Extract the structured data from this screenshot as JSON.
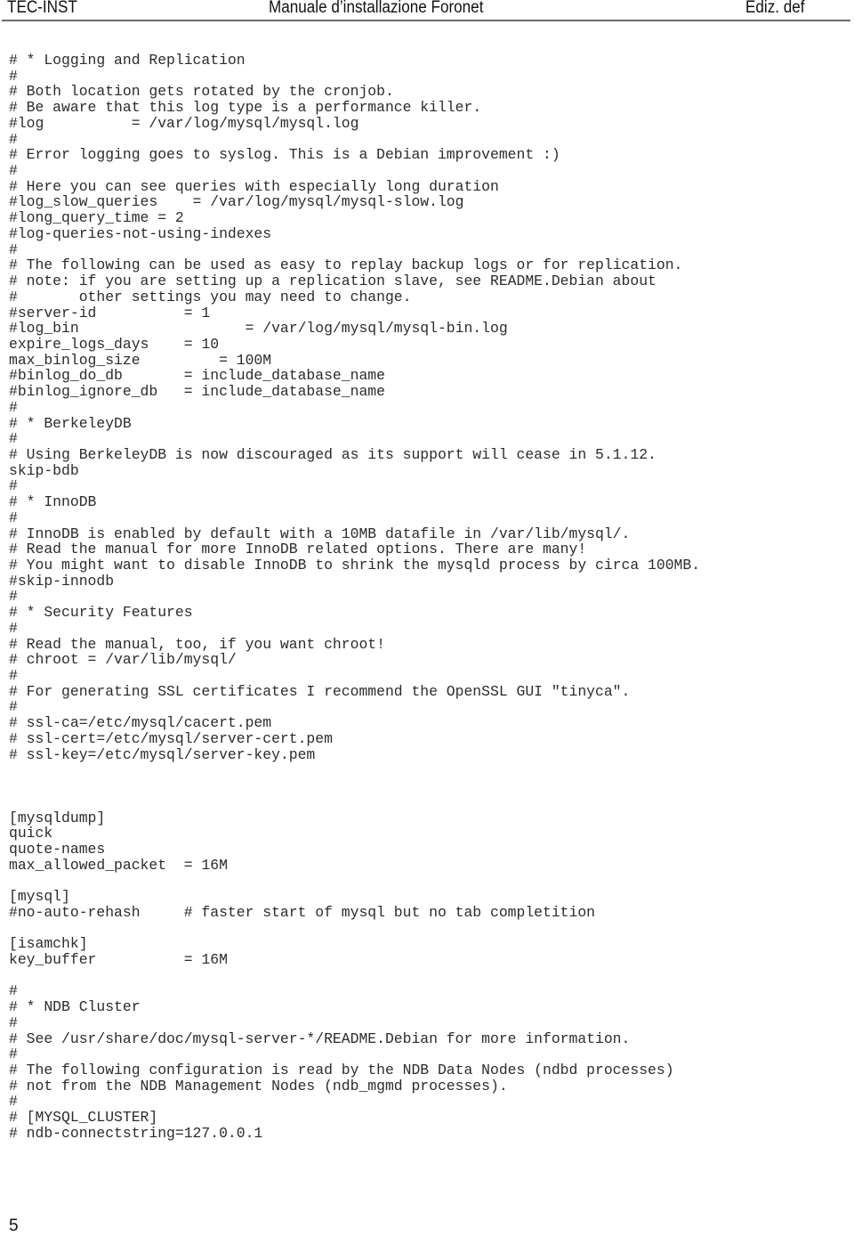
{
  "header": {
    "left": "TEC-INST",
    "center": "Manuale d’installazione Foronet",
    "right": "Ediz. def"
  },
  "code_lines": [
    "# * Logging and Replication",
    "#",
    "# Both location gets rotated by the cronjob.",
    "# Be aware that this log type is a performance killer.",
    "#log          = /var/log/mysql/mysql.log",
    "#",
    "# Error logging goes to syslog. This is a Debian improvement :)",
    "#",
    "# Here you can see queries with especially long duration",
    "#log_slow_queries    = /var/log/mysql/mysql-slow.log",
    "#long_query_time = 2",
    "#log-queries-not-using-indexes",
    "#",
    "# The following can be used as easy to replay backup logs or for replication.",
    "# note: if you are setting up a replication slave, see README.Debian about",
    "#       other settings you may need to change.",
    "#server-id          = 1",
    "#log_bin                   = /var/log/mysql/mysql-bin.log",
    "expire_logs_days    = 10",
    "max_binlog_size         = 100M",
    "#binlog_do_db       = include_database_name",
    "#binlog_ignore_db   = include_database_name",
    "#",
    "# * BerkeleyDB",
    "#",
    "# Using BerkeleyDB is now discouraged as its support will cease in 5.1.12.",
    "skip-bdb",
    "#",
    "# * InnoDB",
    "#",
    "# InnoDB is enabled by default with a 10MB datafile in /var/lib/mysql/.",
    "# Read the manual for more InnoDB related options. There are many!",
    "# You might want to disable InnoDB to shrink the mysqld process by circa 100MB.",
    "#skip-innodb",
    "#",
    "# * Security Features",
    "#",
    "# Read the manual, too, if you want chroot!",
    "# chroot = /var/lib/mysql/",
    "#",
    "# For generating SSL certificates I recommend the OpenSSL GUI \"tinyca\".",
    "#",
    "# ssl-ca=/etc/mysql/cacert.pem",
    "# ssl-cert=/etc/mysql/server-cert.pem",
    "# ssl-key=/etc/mysql/server-key.pem",
    "",
    "",
    "",
    "[mysqldump]",
    "quick",
    "quote-names",
    "max_allowed_packet  = 16M",
    "",
    "[mysql]",
    "#no-auto-rehash     # faster start of mysql but no tab completition",
    "",
    "[isamchk]",
    "key_buffer          = 16M",
    "",
    "#",
    "# * NDB Cluster",
    "#",
    "# See /usr/share/doc/mysql-server-*/README.Debian for more information.",
    "#",
    "# The following configuration is read by the NDB Data Nodes (ndbd processes)",
    "# not from the NDB Management Nodes (ndb_mgmd processes).",
    "#",
    "# [MYSQL_CLUSTER]",
    "# ndb-connectstring=127.0.0.1"
  ],
  "footer": {
    "page_number": "5"
  }
}
